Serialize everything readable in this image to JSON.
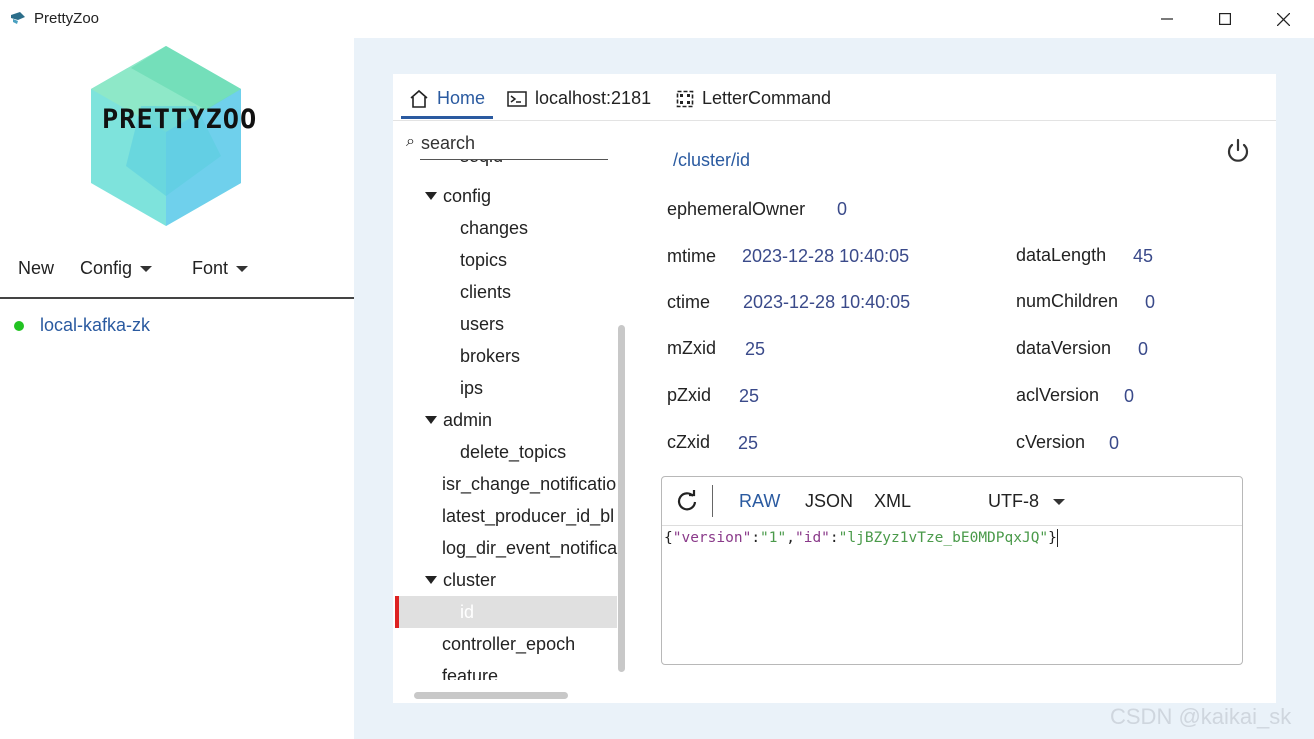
{
  "window": {
    "title": "PrettyZoo"
  },
  "logo": {
    "text": "PRETTYZOO"
  },
  "menu": {
    "new": "New",
    "config": "Config",
    "font": "Font"
  },
  "servers": [
    {
      "name": "local-kafka-zk",
      "status": "connected",
      "status_color": "#22c322"
    }
  ],
  "tabs": [
    {
      "label": "Home",
      "icon": "home-icon",
      "active": true
    },
    {
      "label": "localhost:2181",
      "icon": "terminal-icon"
    },
    {
      "label": "LetterCommand",
      "icon": "frame-icon"
    }
  ],
  "search": {
    "placeholder": "search"
  },
  "tree": {
    "items": [
      {
        "label": "seqid",
        "indent": 2
      },
      {
        "label": "config",
        "indent": 1,
        "expanded": true
      },
      {
        "label": "changes",
        "indent": 2
      },
      {
        "label": "topics",
        "indent": 2
      },
      {
        "label": "clients",
        "indent": 2
      },
      {
        "label": "users",
        "indent": 2
      },
      {
        "label": "brokers",
        "indent": 2
      },
      {
        "label": "ips",
        "indent": 2
      },
      {
        "label": "admin",
        "indent": 1,
        "expanded": true
      },
      {
        "label": "delete_topics",
        "indent": 2
      },
      {
        "label": "isr_change_notificatio",
        "indent": 1
      },
      {
        "label": "latest_producer_id_bl",
        "indent": 1
      },
      {
        "label": "log_dir_event_notifica",
        "indent": 1
      },
      {
        "label": "cluster",
        "indent": 1,
        "expanded": true
      },
      {
        "label": "id",
        "indent": 2,
        "selected": true
      },
      {
        "label": "controller_epoch",
        "indent": 1
      },
      {
        "label": "feature",
        "indent": 1
      }
    ]
  },
  "node": {
    "path": "/cluster/id",
    "ephemeralOwner": {
      "label": "ephemeralOwner",
      "value": "0"
    },
    "mtime": {
      "label": "mtime",
      "value": "2023-12-28 10:40:05"
    },
    "ctime": {
      "label": "ctime",
      "value": "2023-12-28 10:40:05"
    },
    "mZxid": {
      "label": "mZxid",
      "value": "25"
    },
    "pZxid": {
      "label": "pZxid",
      "value": "25"
    },
    "cZxid": {
      "label": "cZxid",
      "value": "25"
    },
    "dataLength": {
      "label": "dataLength",
      "value": "45"
    },
    "numChildren": {
      "label": "numChildren",
      "value": "0"
    },
    "dataVersion": {
      "label": "dataVersion",
      "value": "0"
    },
    "aclVersion": {
      "label": "aclVersion",
      "value": "0"
    },
    "cVersion": {
      "label": "cVersion",
      "value": "0"
    }
  },
  "editor": {
    "formats": {
      "raw": "RAW",
      "json": "JSON",
      "xml": "XML"
    },
    "charset": "UTF-8",
    "content": {
      "open": "{",
      "k1": "\"version\"",
      "colon": ":",
      "v1": "\"1\"",
      "comma": ",",
      "k2": "\"id\"",
      "v2": "\"ljBZyz1vTze_bE0MDPqxJQ\"",
      "close": "}"
    }
  },
  "watermark": "CSDN @kaikai_sk",
  "colors": {
    "accent": "#2a5aa0",
    "selection_marker": "#dd2222",
    "background_right": "#eaf2f9"
  }
}
